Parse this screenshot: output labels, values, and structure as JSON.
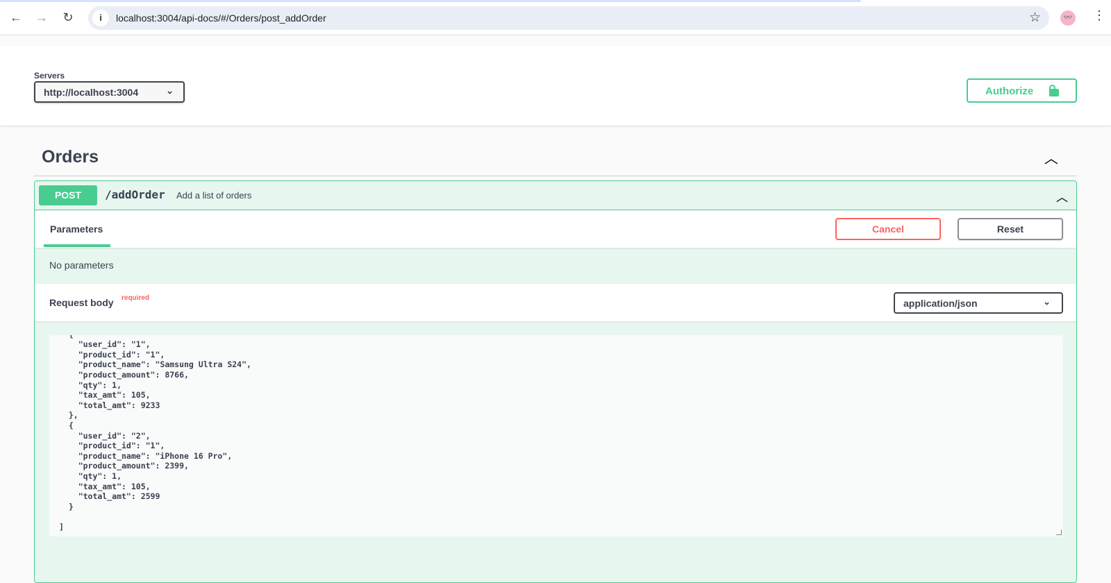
{
  "browser": {
    "url": "localhost:3004/api-docs/#/Orders/post_addOrder",
    "icons": {
      "back": "←",
      "forward": "→",
      "reload": "↻",
      "info": "i",
      "star": "☆",
      "avatar": "👓",
      "menu": "⋮"
    }
  },
  "servers": {
    "label": "Servers",
    "selected": "http://localhost:3004"
  },
  "authorize": {
    "label": "Authorize"
  },
  "tag": {
    "title": "Orders"
  },
  "operation": {
    "method": "POST",
    "path": "/addOrder",
    "description": "Add a list of orders",
    "tab": "Parameters",
    "cancel": "Cancel",
    "reset": "Reset",
    "no_params": "No parameters",
    "request_body": {
      "label": "Request body",
      "required": "required",
      "content_type": "application/json"
    },
    "body": "[\n  {\n    \"user_id\": \"1\",\n    \"product_id\": \"1\",\n    \"product_name\": \"Samsung Ultra S24\",\n    \"product_amount\": 8766,\n    \"qty\": 1,\n    \"tax_amt\": 105,\n    \"total_amt\": 9233\n  },\n  {\n    \"user_id\": \"2\",\n    \"product_id\": \"1\",\n    \"product_name\": \"iPhone 16 Pro\",\n    \"product_amount\": 2399,\n    \"qty\": 1,\n    \"tax_amt\": 105,\n    \"total_amt\": 2599\n  }\n\n]"
  },
  "colors": {
    "post": "#49cc90",
    "cancel": "#ff6060"
  }
}
